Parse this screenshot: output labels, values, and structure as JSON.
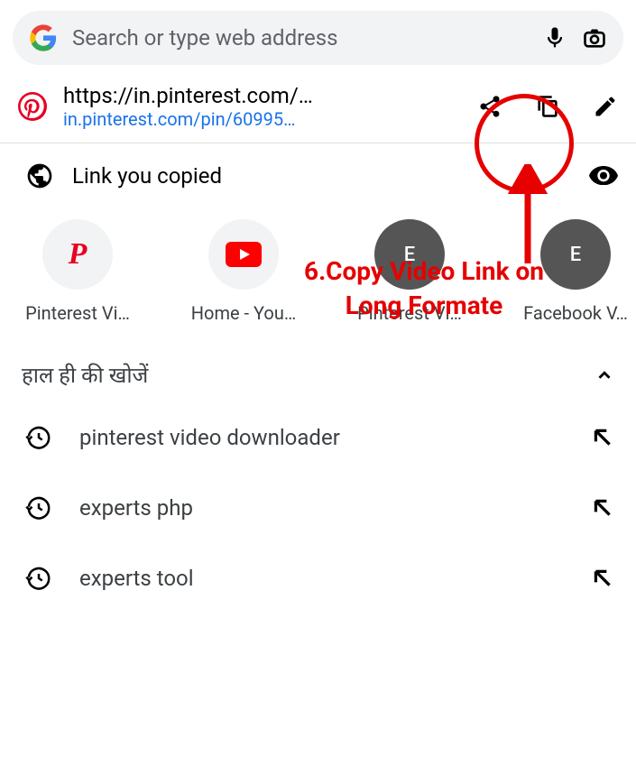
{
  "search": {
    "placeholder": "Search or type web address"
  },
  "pinterest": {
    "url": "https://in.pinterest.com/…",
    "suburl": "in.pinterest.com/pin/60995…"
  },
  "copied": {
    "label": "Link you copied"
  },
  "annotation": {
    "text_line1": "6.Copy Video Link on",
    "text_line2": "Long Formate"
  },
  "shortcuts": [
    {
      "label": "Pinterest Vi…",
      "icon": "P",
      "type": "pinterest"
    },
    {
      "label": "Home - You…",
      "icon": "▶",
      "type": "youtube"
    },
    {
      "label": "Pinterest Vi…",
      "icon": "E",
      "type": "dark"
    },
    {
      "label": "Facebook V…",
      "icon": "E",
      "type": "dark"
    }
  ],
  "recent_header": "हाल ही की खोजें",
  "recent_searches": [
    "pinterest video downloader",
    "experts php",
    "experts tool"
  ]
}
